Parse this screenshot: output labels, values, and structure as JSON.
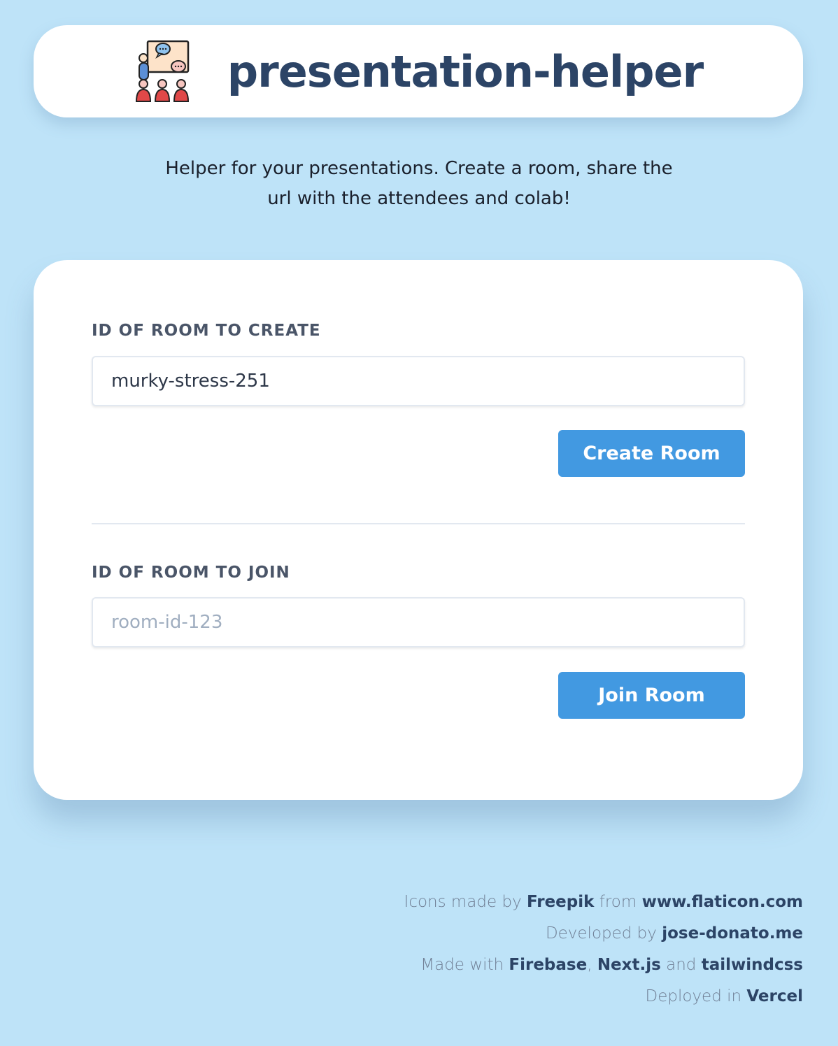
{
  "header": {
    "title": "presentation-helper",
    "logo_icon": "presentation-audience-icon"
  },
  "subtitle": "Helper for your presentations. Create a room, share the url with the attendees and colab!",
  "create_section": {
    "label": "ID OF ROOM TO CREATE",
    "input_value": "murky-stress-251",
    "button_label": "Create Room"
  },
  "join_section": {
    "label": "ID OF ROOM TO JOIN",
    "input_placeholder": "room-id-123",
    "input_value": "",
    "button_label": "Join Room"
  },
  "footer": {
    "line1": {
      "pre": "Icons made by ",
      "link1": "Freepik",
      "mid": " from ",
      "link2": "www.flaticon.com"
    },
    "line2": {
      "pre": "Developed by ",
      "link1": "jose-donato.me"
    },
    "line3": {
      "pre": "Made with ",
      "link1": "Firebase",
      "sep1": ", ",
      "link2": "Next.js",
      "sep2": " and ",
      "link3": "tailwindcss"
    },
    "line4": {
      "pre": "Deployed in ",
      "link1": "Vercel"
    }
  },
  "colors": {
    "background": "#bee3f8",
    "card": "#ffffff",
    "accent_button": "#4299e1",
    "title_text": "#2c4466",
    "label_text": "#4a5568"
  }
}
